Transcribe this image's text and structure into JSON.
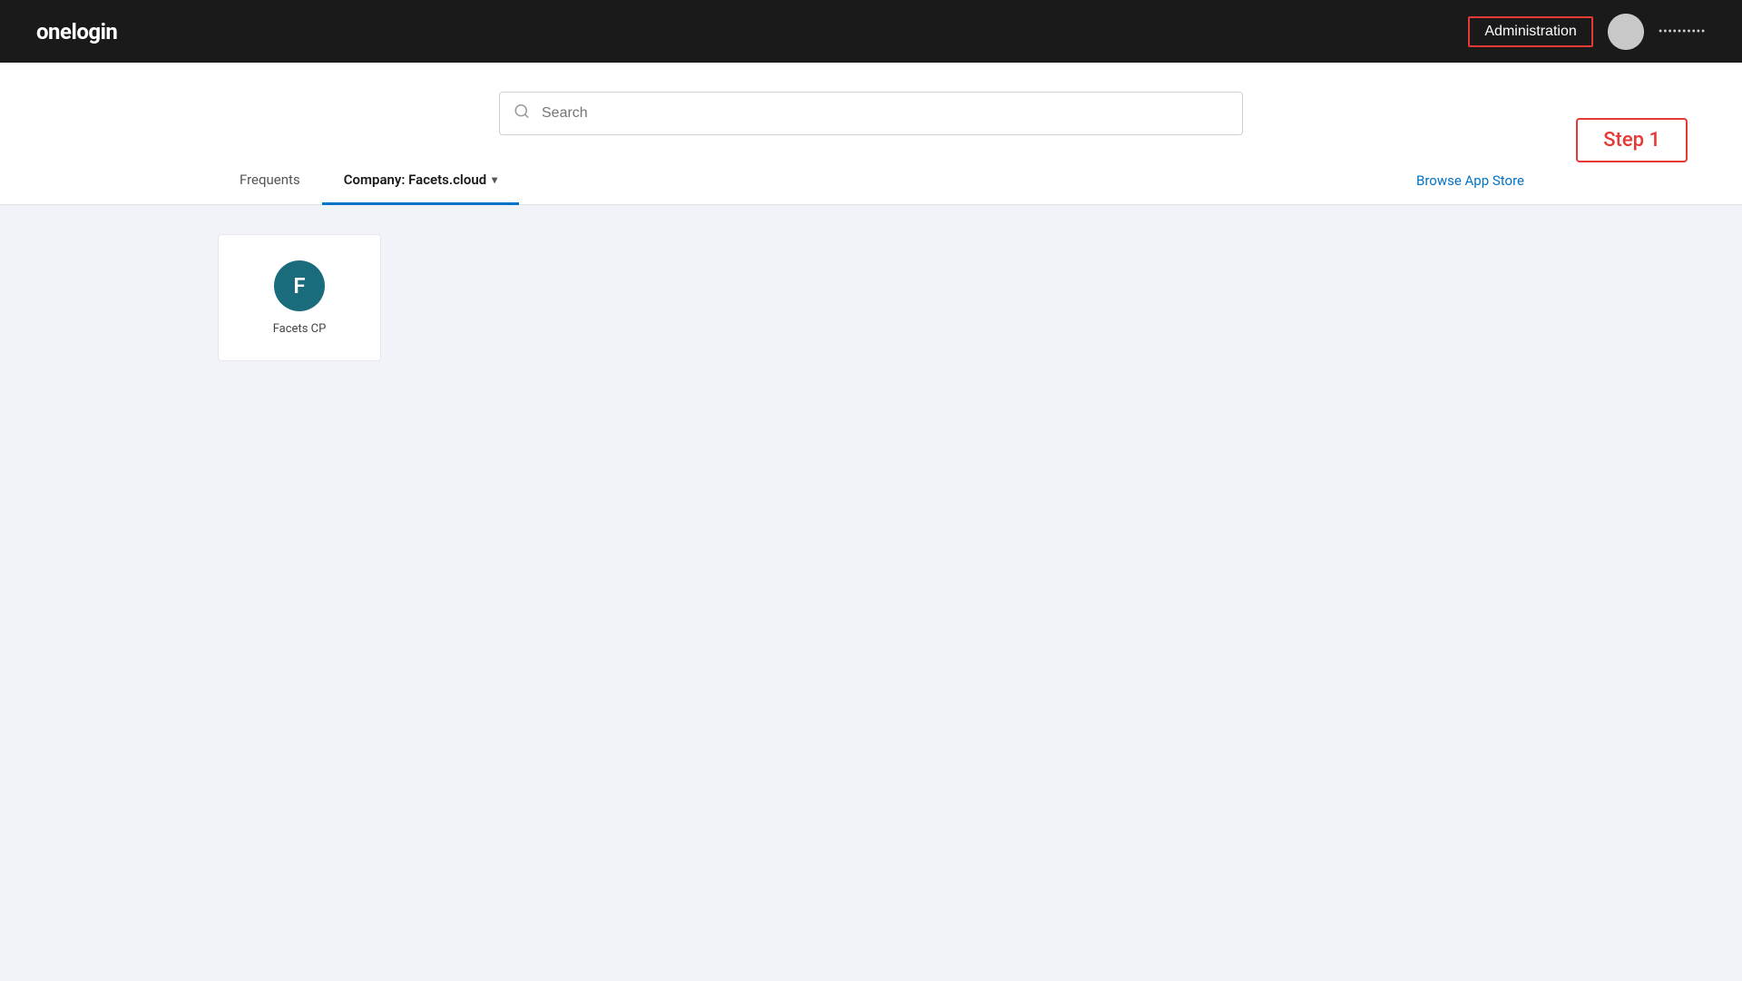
{
  "navbar": {
    "brand": "onelogin",
    "admin_label": "Administration",
    "username": "••••••••••",
    "avatar_alt": "user avatar"
  },
  "search": {
    "placeholder": "Search"
  },
  "tabs": {
    "frequents_label": "Frequents",
    "company_tab_label": "Company: Facets.cloud",
    "active_tab": "company"
  },
  "sidebar": {
    "browse_label": "Browse App Store"
  },
  "step": {
    "label": "Step 1"
  },
  "apps": [
    {
      "id": "facets-cp",
      "icon_letter": "F",
      "icon_color": "#1a6b7c",
      "name": "Facets CP"
    }
  ]
}
